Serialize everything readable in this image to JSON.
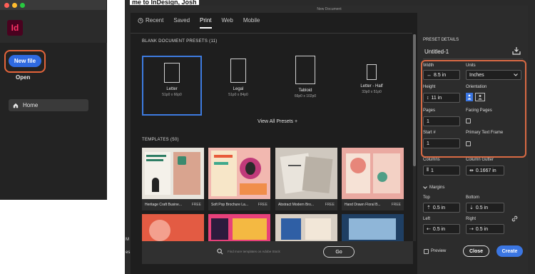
{
  "home": {
    "window_dots": [
      "#ff5f57",
      "#febc2e",
      "#28c840"
    ],
    "logo": "Id",
    "new_file": "New file",
    "open": "Open",
    "home_nav": "Home"
  },
  "background": {
    "welcome": "me to InDesign, Josh"
  },
  "dialog": {
    "title": "New Document",
    "tabs": [
      "Recent",
      "Saved",
      "Print",
      "Web",
      "Mobile"
    ],
    "active_tab": "Print",
    "blank_presets_label": "BLANK DOCUMENT PRESETS",
    "blank_presets_count": "(11)",
    "presets": [
      {
        "name": "Letter",
        "dims": "51p0 x 66p0"
      },
      {
        "name": "Legal",
        "dims": "51p0 x 84p0"
      },
      {
        "name": "Tabloid",
        "dims": "66p0 x 102p0"
      },
      {
        "name": "Letter - Half",
        "dims": "33p0 x 51p0"
      }
    ],
    "view_all": "View All Presets +",
    "templates_label": "TEMPLATES",
    "templates_count": "(50)",
    "templates": [
      {
        "name": "Heritage Craft Busine...",
        "badge": "FREE"
      },
      {
        "name": "Soft Pop Brochure La...",
        "badge": "FREE"
      },
      {
        "name": "Abstract Modern Bro...",
        "badge": "FREE"
      },
      {
        "name": "Hand Drawn Floral B...",
        "badge": "FREE"
      }
    ],
    "search_placeholder": "Find more templates on Adobe Stock",
    "go": "Go"
  },
  "details": {
    "heading": "PRESET DETAILS",
    "doc_name": "Untitled-1",
    "width_label": "Width",
    "width_value": "8.5 in",
    "units_label": "Units",
    "units_value": "Inches",
    "height_label": "Height",
    "height_value": "11 in",
    "orientation_label": "Orientation",
    "pages_label": "Pages",
    "pages_value": "1",
    "facing_label": "Facing Pages",
    "start_label": "Start #",
    "start_value": "1",
    "primary_frame_label": "Primary Text Frame",
    "columns_label": "Columns",
    "columns_value": "1",
    "gutter_label": "Column Gutter",
    "gutter_value": "0.1667 in",
    "margins_label": "Margins",
    "top_label": "Top",
    "top_value": "0.5 in",
    "bottom_label": "Bottom",
    "bottom_value": "0.5 in",
    "left_label": "Left",
    "left_value": "0.5 in",
    "right_label": "Right",
    "right_value": "0.5 in",
    "preview_label": "Preview",
    "close": "Close",
    "create": "Create"
  },
  "edge": {
    "right_a": "ro",
    "right_b": "ch",
    "left_a": "M",
    "left_b": "es",
    "left_c": "er"
  }
}
